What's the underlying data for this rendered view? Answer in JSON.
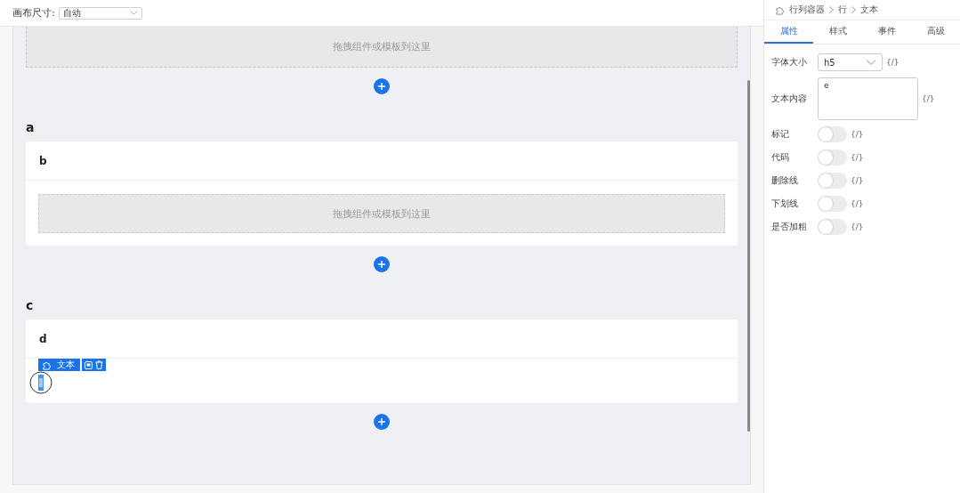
{
  "toolbar": {
    "label": "画布尺寸:",
    "value": "自动"
  },
  "top_dropzone": {
    "text": "拖拽组件或模板到这里"
  },
  "groups": [
    {
      "title": "a",
      "card_title": "b",
      "content": {
        "kind": "dropzone",
        "text": "拖拽组件或模板到这里"
      }
    },
    {
      "title": "c",
      "card_title": "d",
      "content": {
        "kind": "selected",
        "tag": "文本"
      }
    }
  ],
  "panel": {
    "breadcrumb": [
      "行列容器",
      "行",
      "文本"
    ],
    "tabs": [
      {
        "label": "属性",
        "selected": true
      },
      {
        "label": "样式",
        "selected": false
      },
      {
        "label": "事件",
        "selected": false
      },
      {
        "label": "高级",
        "selected": false
      }
    ],
    "fields": [
      {
        "kind": "select",
        "label": "字体大小",
        "value": "h5",
        "binding": "{/}"
      },
      {
        "kind": "textarea",
        "label": "文本内容",
        "value": "e",
        "binding": "{/}"
      },
      {
        "kind": "switch",
        "label": "标记",
        "on": false,
        "binding": "{/}"
      },
      {
        "kind": "switch",
        "label": "代码",
        "on": false,
        "binding": "{/}"
      },
      {
        "kind": "switch",
        "label": "删除线",
        "on": false,
        "binding": "{/}"
      },
      {
        "kind": "switch",
        "label": "下划线",
        "on": false,
        "binding": "{/}"
      },
      {
        "kind": "switch",
        "label": "是否加粗",
        "on": false,
        "binding": "{/}"
      }
    ]
  }
}
